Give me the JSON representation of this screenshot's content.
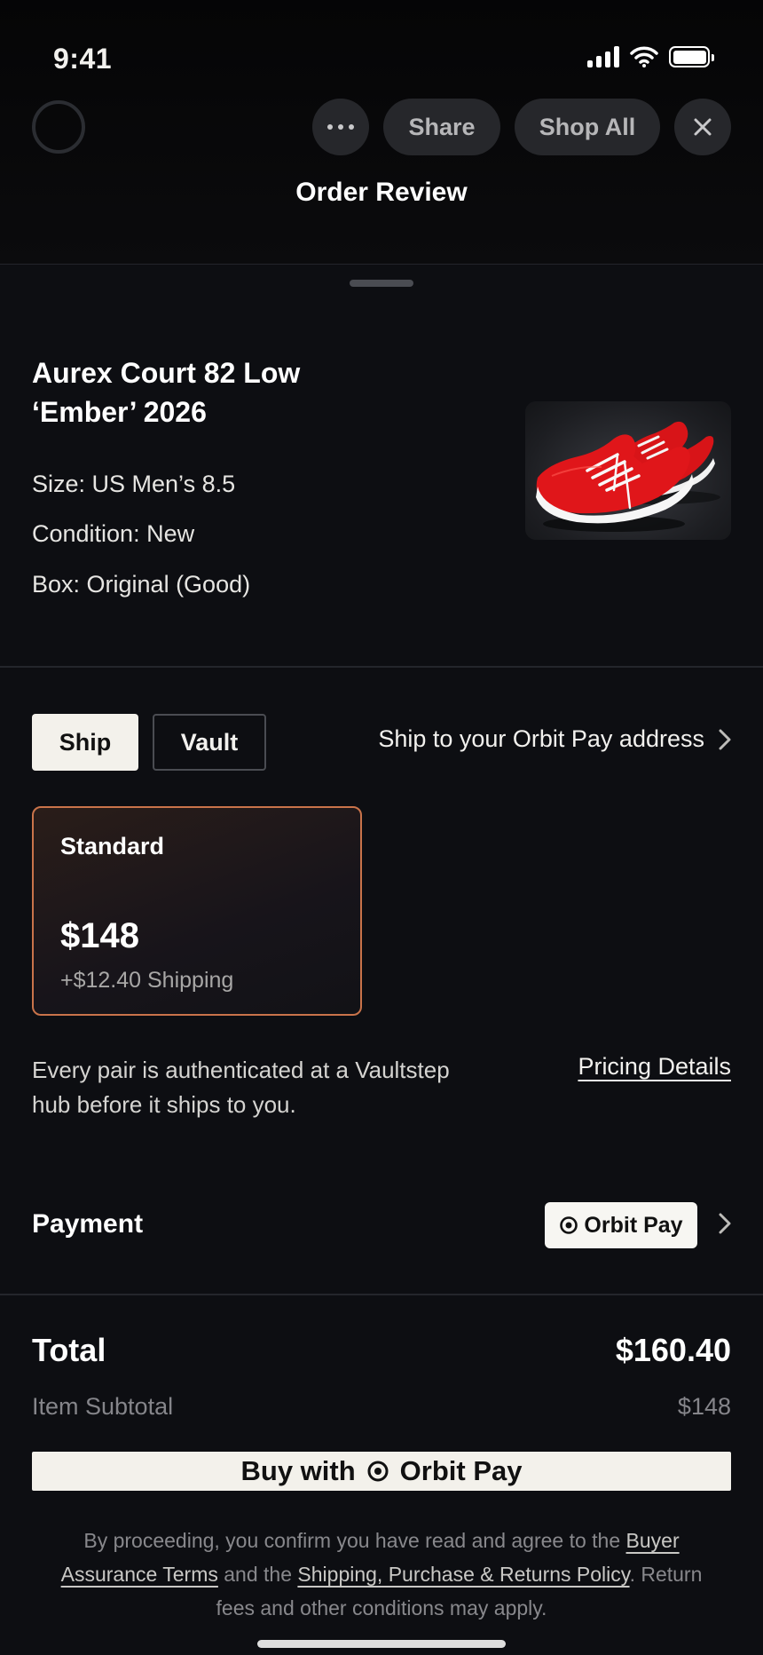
{
  "status_bar": {
    "time": "9:41"
  },
  "nav": {
    "share_label": "Share",
    "shop_all_label": "Shop All",
    "title": "Order Review"
  },
  "product": {
    "name": "Aurex Court 82 Low ‘Ember’ 2026",
    "size": "Size: US Men’s 8.5",
    "condition": "Condition: New",
    "box": "Box: Original (Good)"
  },
  "delivery": {
    "tabs": [
      "Ship",
      "Vault"
    ],
    "selected_tab": "Ship",
    "ship_to": "Ship to your Orbit Pay address",
    "option": {
      "title": "Standard",
      "price": "$148",
      "shipping": "+$12.40 Shipping"
    }
  },
  "auth_note": "Every pair is authenticated at a Vaultstep hub before it ships to you.",
  "pricing_details": "Pricing Details",
  "payment": {
    "label": "Payment",
    "method": "Orbit Pay"
  },
  "summary": {
    "total_label": "Total",
    "total_value": "$160.40",
    "subtotal_label": "Item Subtotal",
    "subtotal_value": "$148"
  },
  "buy_button": {
    "prefix": "Buy with",
    "brand": "Orbit Pay"
  },
  "legal": {
    "part1": "By proceeding, you confirm you have read and agree to the ",
    "link1": "Buyer Assurance Terms",
    "part2": " and the ",
    "link2": "Shipping, Purchase & Returns Policy",
    "part3": ". Return fees and other conditions may apply."
  },
  "colors": {
    "background": "#0d0e12",
    "accent_border": "#c9734a",
    "button_light": "#f3f1eb",
    "shoe_red": "#e0161a"
  }
}
